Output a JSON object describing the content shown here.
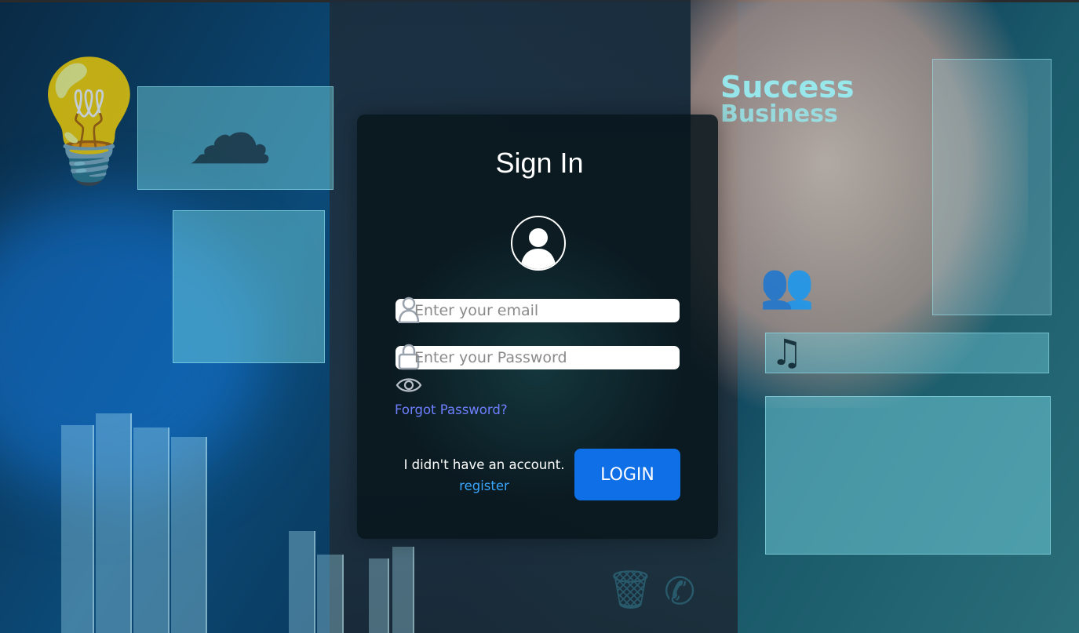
{
  "login": {
    "title": "Sign In",
    "email_placeholder": "Enter your email",
    "password_placeholder": "Enter your Password",
    "forgot_label": "Forgot Password?",
    "no_account_text": "I didn't have an account.",
    "register_label": "register",
    "login_label": "LOGIN"
  },
  "icons": {
    "avatar": "user-avatar-icon",
    "email": "user-icon",
    "password": "lock-icon",
    "show_password": "eye-icon"
  },
  "background": {
    "headline": "Success",
    "subline": "Business"
  },
  "colors": {
    "button": "#0f6fe6",
    "forgot_link": "#6f7fff",
    "register_link": "#3aa6ff",
    "card": "#08161c"
  }
}
